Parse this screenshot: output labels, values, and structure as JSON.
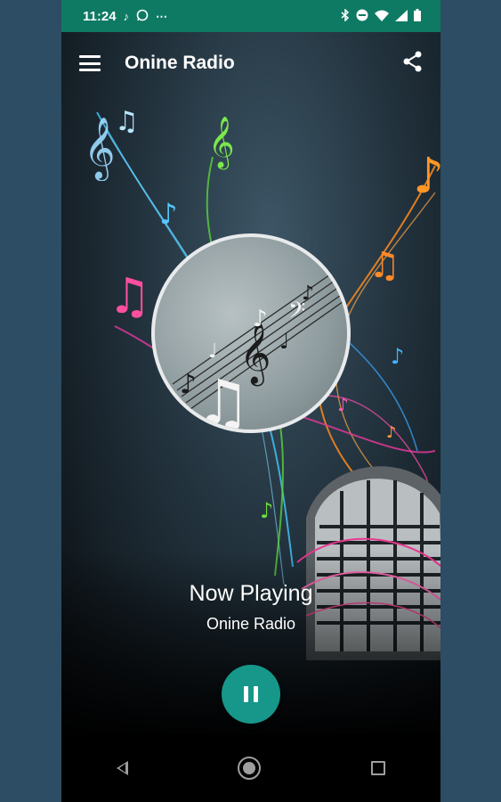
{
  "status_bar": {
    "time": "11:24",
    "notification_icons": [
      "music-note-icon",
      "whatsapp-icon",
      "more-dots-icon"
    ],
    "system_icons": [
      "bluetooth-icon",
      "do-not-disturb-icon",
      "wifi-icon",
      "signal-icon",
      "battery-icon"
    ]
  },
  "toolbar": {
    "title": "Onine Radio",
    "menu_icon": "hamburger-menu-icon",
    "share_icon": "share-icon"
  },
  "now_playing": {
    "heading": "Now Playing",
    "station": "Onine Radio"
  },
  "player": {
    "state": "playing",
    "button_icon": "pause-icon",
    "accent_color": "#17968a"
  },
  "colors": {
    "status_bar": "#0e7a64",
    "background": "#2c4d63"
  },
  "nav_bar": {
    "buttons": [
      "back-icon",
      "home-icon",
      "recents-icon"
    ]
  }
}
